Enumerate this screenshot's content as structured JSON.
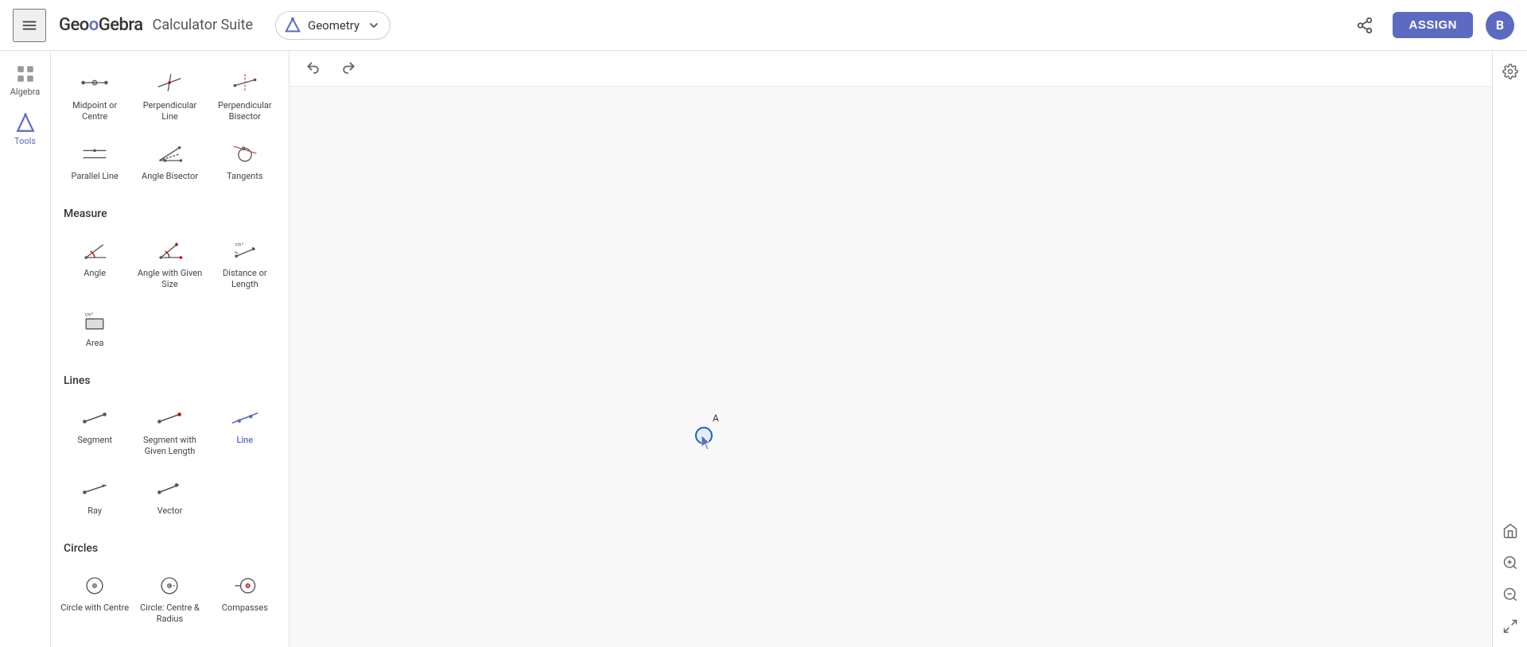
{
  "header": {
    "menu_icon": "menu-icon",
    "logo": "GeoGebra",
    "suite": "Calculator Suite",
    "app_name": "Geometry",
    "share_icon": "share-icon",
    "assign_label": "ASSIGN",
    "avatar_label": "B"
  },
  "sidebar": {
    "items": [
      {
        "id": "algebra",
        "label": "Algebra",
        "icon": "grid-icon"
      },
      {
        "id": "tools",
        "label": "Tools",
        "icon": "tools-icon",
        "active": true
      }
    ]
  },
  "tools_panel": {
    "sections": [
      {
        "id": "construct",
        "title": "",
        "tools": [
          {
            "id": "midpoint",
            "label": "Midpoint or Centre",
            "active": false
          },
          {
            "id": "perpendicular-line",
            "label": "Perpendicular Line",
            "active": false
          },
          {
            "id": "perpendicular-bisector",
            "label": "Perpendicular Bisector",
            "active": false
          },
          {
            "id": "parallel-line",
            "label": "Parallel Line",
            "active": false
          },
          {
            "id": "angle-bisector",
            "label": "Angle Bisector",
            "active": false
          },
          {
            "id": "tangents",
            "label": "Tangents",
            "active": false
          }
        ]
      },
      {
        "id": "measure",
        "title": "Measure",
        "tools": [
          {
            "id": "angle",
            "label": "Angle",
            "active": false
          },
          {
            "id": "angle-given-size",
            "label": "Angle with Given Size",
            "active": false
          },
          {
            "id": "distance-length",
            "label": "Distance or Length",
            "active": false
          },
          {
            "id": "area",
            "label": "Area",
            "active": false
          }
        ]
      },
      {
        "id": "lines",
        "title": "Lines",
        "tools": [
          {
            "id": "segment",
            "label": "Segment",
            "active": false
          },
          {
            "id": "segment-given-length",
            "label": "Segment with Given Length",
            "active": false
          },
          {
            "id": "line",
            "label": "Line",
            "active": true
          },
          {
            "id": "ray",
            "label": "Ray",
            "active": false
          },
          {
            "id": "vector",
            "label": "Vector",
            "active": false
          }
        ]
      },
      {
        "id": "circles",
        "title": "Circles",
        "tools": [
          {
            "id": "circle-centre",
            "label": "Circle with Centre",
            "active": false
          },
          {
            "id": "circle-centre-radius",
            "label": "Circle: Centre & Radius",
            "active": false
          },
          {
            "id": "compasses",
            "label": "Compasses",
            "active": false
          }
        ]
      }
    ]
  },
  "canvas": {
    "undo_label": "↩",
    "redo_label": "↪",
    "point_label": "A"
  },
  "right_sidebar": {
    "settings_icon": "settings-icon",
    "home_icon": "home-icon",
    "zoom_in_icon": "zoom-in-icon",
    "zoom_out_icon": "zoom-out-icon",
    "fullscreen_icon": "fullscreen-icon"
  }
}
